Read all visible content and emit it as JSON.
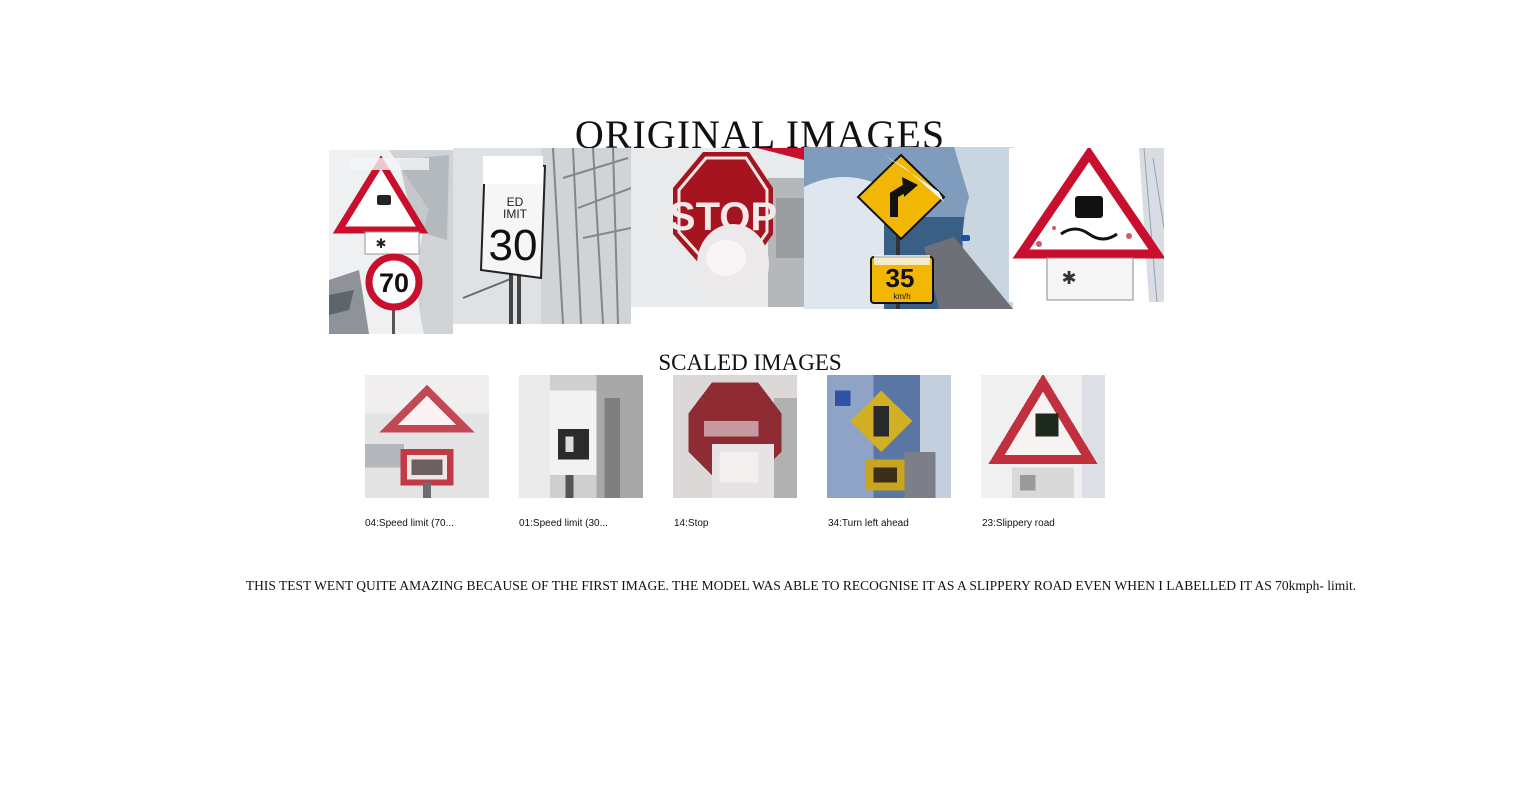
{
  "title": "ORIGINAL IMAGES",
  "subtitle": "SCALED IMAGES",
  "originals": [
    {
      "sign": "slippery-road-warning-with-70-speed-limit",
      "texts": [
        "70"
      ]
    },
    {
      "sign": "speed-limit-30",
      "texts": [
        "ED",
        "IMIT",
        "30"
      ]
    },
    {
      "sign": "stop",
      "texts": [
        "STOP"
      ]
    },
    {
      "sign": "turn-left-ahead-35-kmh",
      "texts": [
        "35",
        "km/h"
      ]
    },
    {
      "sign": "slippery-road-warning",
      "texts": []
    }
  ],
  "captions": [
    "04:Speed limit (70...",
    "01:Speed limit (30...",
    "14:Stop",
    "34:Turn left ahead",
    "23:Slippery road"
  ],
  "note": "THIS TEST WENT QUITE AMAZING BECAUSE OF THE FIRST IMAGE. THE MODEL WAS ABLE TO RECOGNISE IT AS A SLIPPERY ROAD EVEN WHEN I LABELLED IT AS 70kmph- limit.",
  "colors": {
    "sign_red": "#c8102e",
    "sign_yellow": "#f2b705",
    "snow": "#f2f4f6",
    "sky_blue": "#2f5d8c"
  }
}
